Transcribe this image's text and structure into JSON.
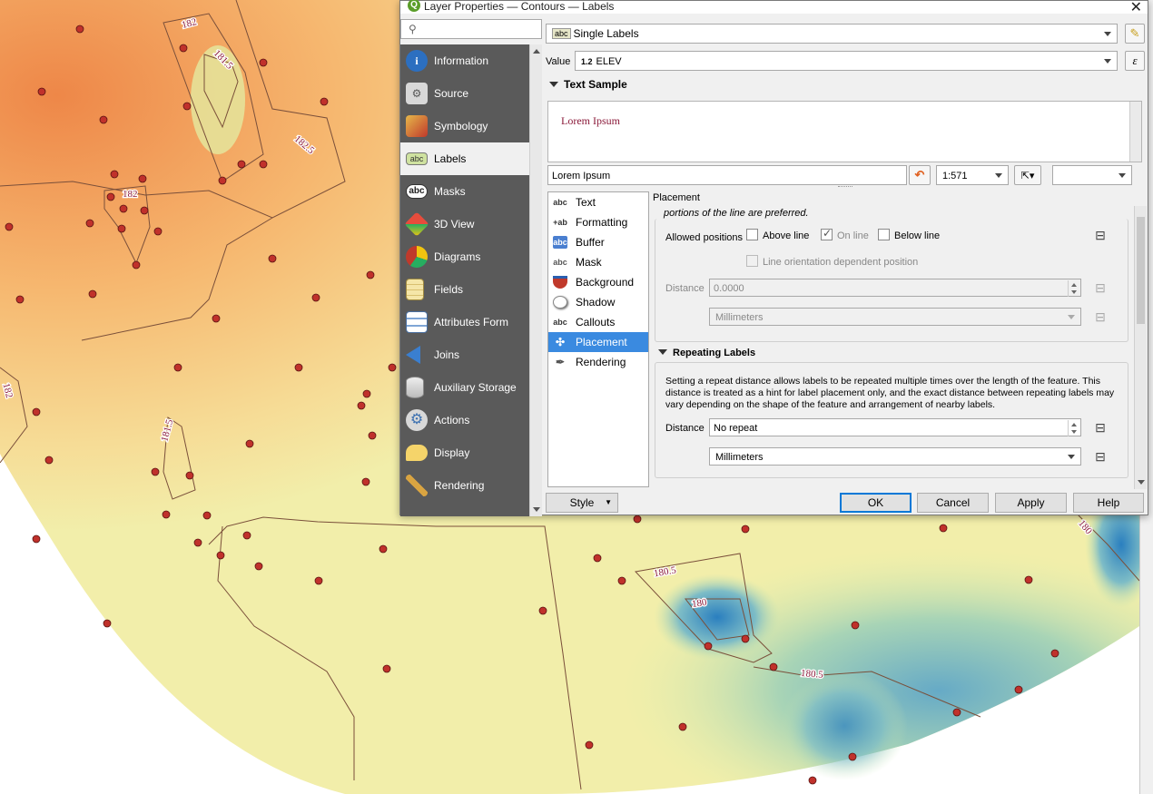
{
  "dialog": {
    "title": "Layer Properties — Contours — Labels",
    "app_icon": "qgis-logo-icon"
  },
  "sidebar": {
    "search_placeholder": "",
    "items": [
      {
        "label": "Information",
        "icon": "information-icon"
      },
      {
        "label": "Source",
        "icon": "source-icon"
      },
      {
        "label": "Symbology",
        "icon": "symbology-icon"
      },
      {
        "label": "Labels",
        "icon": "labels-icon"
      },
      {
        "label": "Masks",
        "icon": "masks-icon"
      },
      {
        "label": "3D View",
        "icon": "3d-view-icon"
      },
      {
        "label": "Diagrams",
        "icon": "diagrams-icon"
      },
      {
        "label": "Fields",
        "icon": "fields-icon"
      },
      {
        "label": "Attributes Form",
        "icon": "attributes-form-icon"
      },
      {
        "label": "Joins",
        "icon": "joins-icon"
      },
      {
        "label": "Auxiliary Storage",
        "icon": "auxiliary-storage-icon"
      },
      {
        "label": "Actions",
        "icon": "actions-icon"
      },
      {
        "label": "Display",
        "icon": "display-icon"
      },
      {
        "label": "Rendering",
        "icon": "rendering-icon"
      }
    ],
    "active": "Labels"
  },
  "labeling": {
    "mode_badge": "abc",
    "mode": "Single Labels",
    "value_label": "Value",
    "value_type": "1.2",
    "value_field": "ELEV",
    "expression_symbol": "ε"
  },
  "text_sample": {
    "header": "Text Sample",
    "preview_text": "Lorem Ipsum",
    "input_value": "Lorem Ipsum",
    "scale": "1:571"
  },
  "tabs": {
    "items": [
      {
        "label": "Text",
        "icon": "abc"
      },
      {
        "label": "Formatting",
        "icon": "+ab"
      },
      {
        "label": "Buffer",
        "icon": "abc"
      },
      {
        "label": "Mask",
        "icon": "abc"
      },
      {
        "label": "Background",
        "icon": ""
      },
      {
        "label": "Shadow",
        "icon": ""
      },
      {
        "label": "Callouts",
        "icon": "abc"
      },
      {
        "label": "Placement",
        "icon": ""
      },
      {
        "label": "Rendering",
        "icon": ""
      }
    ],
    "active": "Placement"
  },
  "placement": {
    "header": "Placement",
    "truncated_text": "portions of the line are preferred.",
    "allowed_positions_label": "Allowed positions",
    "above_line": {
      "label": "Above line",
      "checked": false
    },
    "on_line": {
      "label": "On line",
      "checked": true
    },
    "below_line": {
      "label": "Below line",
      "checked": false
    },
    "orientation": {
      "label": "Line orientation dependent position",
      "checked": false
    },
    "distance_label": "Distance",
    "distance_value": "0.0000",
    "distance_units": "Millimeters"
  },
  "repeating": {
    "header": "Repeating Labels",
    "description": "Setting a repeat distance allows labels to be repeated multiple times over the length of the feature. This distance is treated as a hint for label placement only, and the exact distance between repeating labels may vary depending on the shape of the feature and arrangement of nearby labels.",
    "distance_label": "Distance",
    "distance_value": "No repeat",
    "units": "Millimeters"
  },
  "buttons": {
    "style": "Style",
    "ok": "OK",
    "cancel": "Cancel",
    "apply": "Apply",
    "help": "Help"
  },
  "map": {
    "contour_labels": [
      "182",
      "181.5",
      "182.5",
      "182",
      "182",
      "181.5",
      "180.5",
      "180",
      "180.5",
      "180"
    ],
    "colors": {
      "high": "#f08a4b",
      "mid": "#eef0a8",
      "low": "#2f7fc0",
      "point": "#c0312b"
    }
  }
}
